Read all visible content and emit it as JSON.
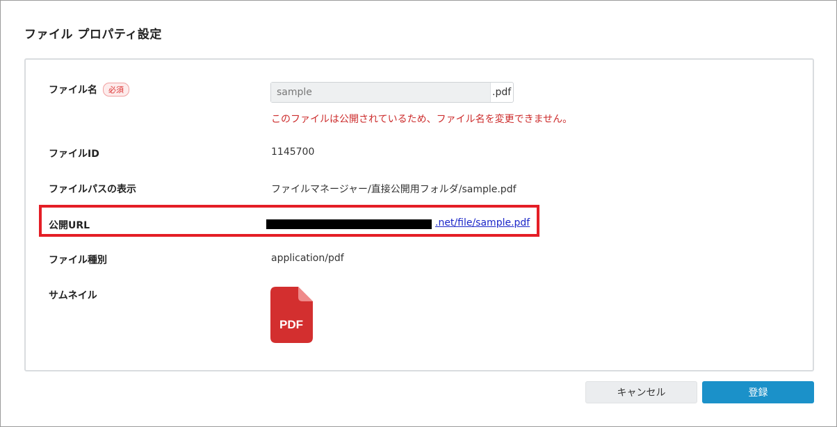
{
  "dialog": {
    "title": "ファイル プロパティ設定"
  },
  "fields": {
    "filename": {
      "label": "ファイル名",
      "required_badge": "必須",
      "value": "sample",
      "extension": ".pdf",
      "error": "このファイルは公開されているため、ファイル名を変更できません。"
    },
    "file_id": {
      "label": "ファイルID",
      "value": "1145700"
    },
    "file_path": {
      "label": "ファイルパスの表示",
      "value": "ファイルマネージャー/直接公開用フォルダ/sample.pdf"
    },
    "public_url": {
      "label": "公開URL",
      "link_text": ".net/file/sample.pdf"
    },
    "file_type": {
      "label": "ファイル種別",
      "value": "application/pdf"
    },
    "thumbnail": {
      "label": "サムネイル",
      "icon_text": "PDF",
      "icon": "pdf-file-icon",
      "color": "#d32f2f"
    }
  },
  "buttons": {
    "cancel": "キャンセル",
    "submit": "登録"
  },
  "colors": {
    "highlight": "#e41e26",
    "error": "#cc2b2b",
    "primary": "#1b91c9",
    "link": "#1a25c8"
  }
}
